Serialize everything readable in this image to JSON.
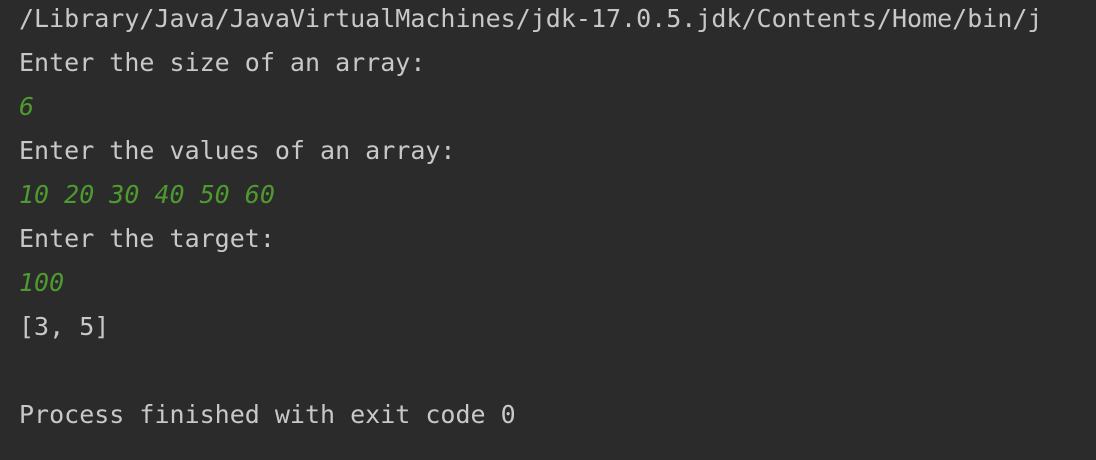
{
  "console": {
    "command_path": "/Library/Java/JavaVirtualMachines/jdk-17.0.5.jdk/Contents/Home/bin/j",
    "prompt_size": "Enter the size of an array:",
    "input_size": "6",
    "prompt_values": "Enter the values of an array:",
    "input_values": "10 20 30 40 50 60",
    "prompt_target": "Enter the target:",
    "input_target": "100",
    "result": "[3, 5]",
    "exit_message": "Process finished with exit code 0"
  },
  "colors": {
    "background": "#2b2b2b",
    "output_text": "#c8c8c8",
    "user_input": "#4e9a2f"
  }
}
